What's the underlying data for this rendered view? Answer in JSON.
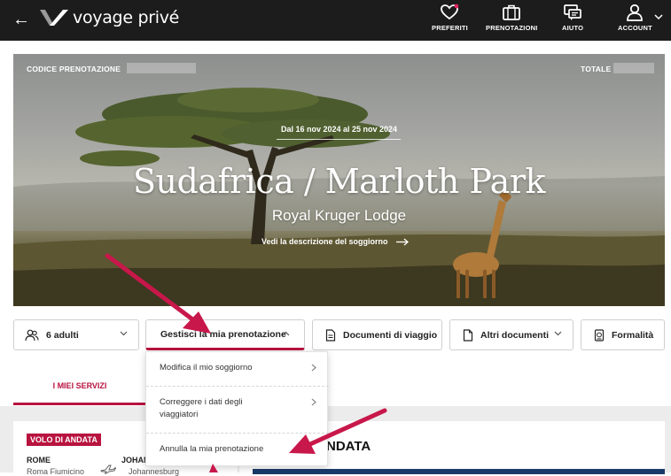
{
  "header": {
    "back_label": "←",
    "logo_text": "voyage privé",
    "nav": [
      {
        "label": "PREFERITI",
        "icon": "heart-icon",
        "notification_dot_color": "#e0245e"
      },
      {
        "label": "PRENOTAZIONI",
        "icon": "suitcase-icon"
      },
      {
        "label": "AIUTO",
        "icon": "chat-help-icon"
      },
      {
        "label": "ACCOUNT",
        "icon": "user-icon"
      }
    ]
  },
  "booking": {
    "code_label": "CODICE PRENOTAZIONE",
    "total_label": "TOTALE",
    "dates": "Dal 16 nov 2024 al 25 nov 2024",
    "title": "Sudafrica / Marloth Park",
    "subtitle": "Royal Kruger Lodge",
    "description_link": "Vedi la descrizione del soggiorno"
  },
  "actions": {
    "travellers": "6 adulti",
    "manage": "Gestisci la mia prenotazione",
    "documents": "Documenti di viaggio",
    "other_documents": "Altri documenti",
    "formalities": "Formalità"
  },
  "manage_menu": {
    "items": [
      {
        "label": "Modifica il mio soggiorno"
      },
      {
        "label_line1": "Correggere i dati degli",
        "label_line2": "viaggiatori"
      },
      {
        "label": "Annulla la mia prenotazione"
      }
    ]
  },
  "tabs": {
    "services": "I MIEI SERVIZI"
  },
  "flight": {
    "badge": "VOLO DI ANDATA",
    "from_city": "ROME",
    "from_airport": "Roma Fiumicino",
    "to_city": "JOHAN",
    "to_airport": "Johannesburg"
  },
  "right_card": {
    "title": "NDATA"
  },
  "colors": {
    "accent": "#b8133f",
    "topbar": "#1c1c1c",
    "annotation_arrow": "#c8174a"
  }
}
